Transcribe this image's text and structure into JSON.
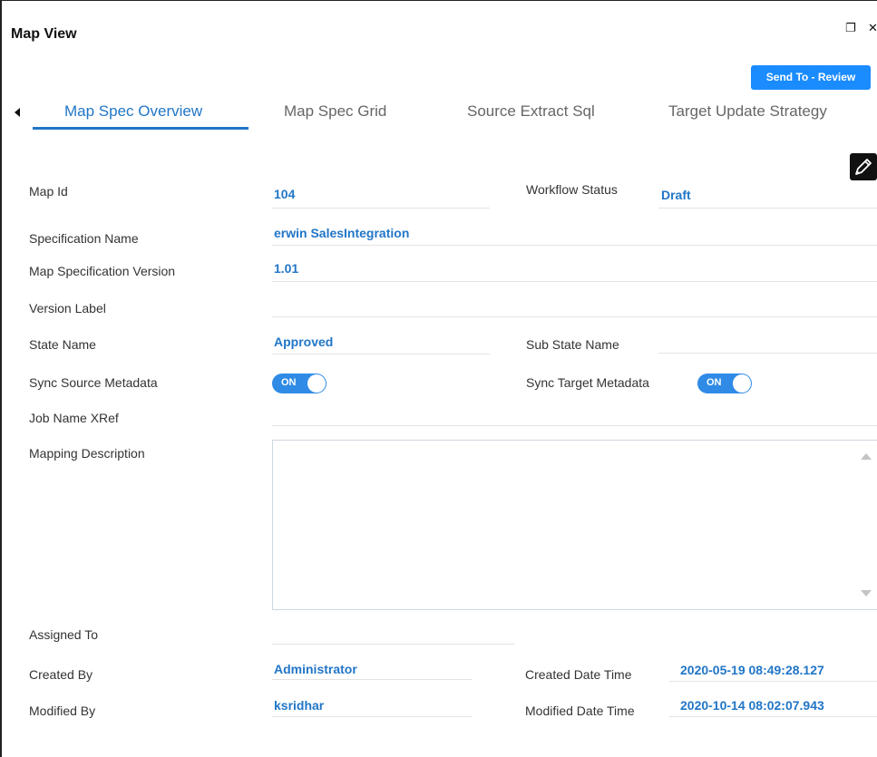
{
  "window": {
    "title": "Map View",
    "restore_glyph": "❐",
    "close_glyph": "✕",
    "icons": [
      "restore-icon",
      "close-icon"
    ]
  },
  "toolbar": {
    "send_label": "Send To - Review"
  },
  "tabs": [
    {
      "label": "Map Spec Overview",
      "active": true
    },
    {
      "label": "Map Spec Grid",
      "active": false
    },
    {
      "label": "Source Extract Sql",
      "active": false
    },
    {
      "label": "Target Update Strategy",
      "active": false
    }
  ],
  "fields": {
    "map_id": {
      "label": "Map Id",
      "value": "104"
    },
    "workflow_status": {
      "label": "Workflow Status",
      "value": "Draft"
    },
    "specification_name": {
      "label": "Specification Name",
      "value": "erwin SalesIntegration"
    },
    "map_spec_version": {
      "label": "Map Specification Version",
      "value": "1.01"
    },
    "version_label": {
      "label": "Version Label",
      "value": ""
    },
    "state_name": {
      "label": "State Name",
      "value": "Approved"
    },
    "sub_state_name": {
      "label": "Sub State Name",
      "value": ""
    },
    "sync_source": {
      "label": "Sync Source Metadata",
      "value": "ON"
    },
    "sync_target": {
      "label": "Sync Target Metadata",
      "value": "ON"
    },
    "job_name_xref": {
      "label": "Job Name XRef",
      "value": ""
    },
    "mapping_description": {
      "label": "Mapping Description",
      "value": ""
    },
    "assigned_to": {
      "label": "Assigned To",
      "value": ""
    },
    "created_by": {
      "label": "Created By",
      "value": "Administrator"
    },
    "created_date_time": {
      "label": "Created Date Time",
      "value": "2020-05-19 08:49:28.127"
    },
    "modified_by": {
      "label": "Modified By",
      "value": "ksridhar"
    },
    "modified_date_time": {
      "label": "Modified Date Time",
      "value": "2020-10-14 08:02:07.943"
    }
  },
  "colors": {
    "accent": "#2176c7",
    "button": "#1a8cff",
    "toggle": "#2f8be6"
  }
}
